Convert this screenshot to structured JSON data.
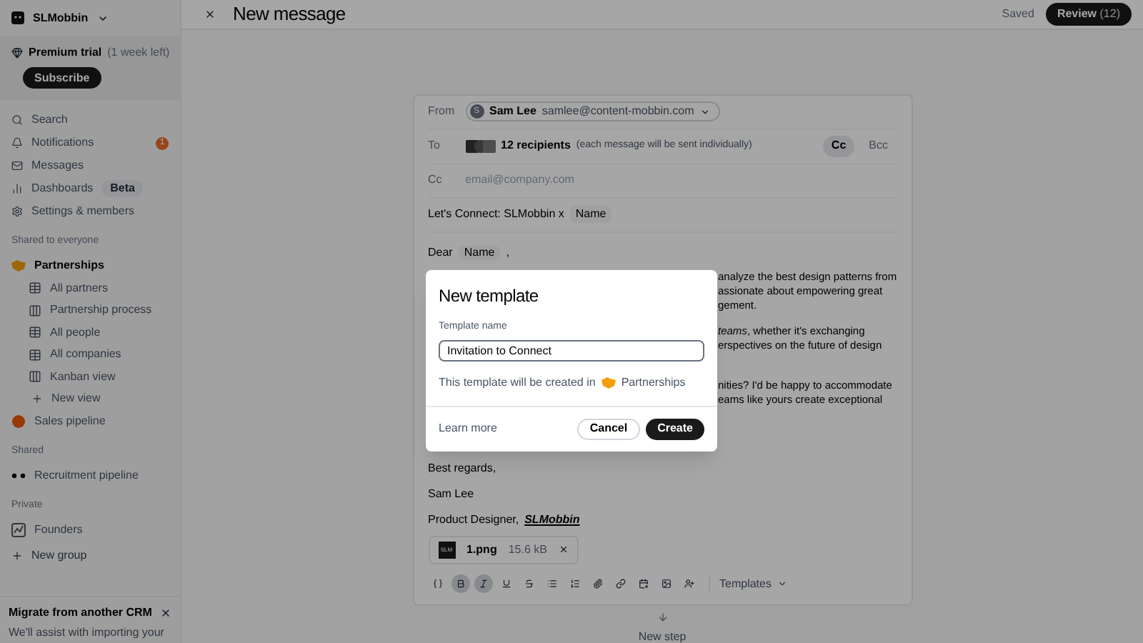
{
  "workspace": {
    "name": "SLMobbin"
  },
  "trial": {
    "label": "Premium trial",
    "note": "(1 week left)",
    "button": "Subscribe"
  },
  "nav": [
    {
      "label": "Search"
    },
    {
      "label": "Notifications",
      "badge": "1"
    },
    {
      "label": "Messages"
    },
    {
      "label": "Dashboards",
      "tag": "Beta"
    },
    {
      "label": "Settings & members"
    }
  ],
  "sections": [
    {
      "title": "Shared to everyone",
      "items": [
        {
          "label": "Partnerships",
          "expanded": true,
          "children": [
            {
              "label": "All partners"
            },
            {
              "label": "Partnership process"
            },
            {
              "label": "All people"
            },
            {
              "label": "All companies"
            },
            {
              "label": "Kanban view"
            }
          ],
          "action": "New view"
        },
        {
          "label": "Sales pipeline",
          "expanded": false
        }
      ]
    },
    {
      "title": "Shared",
      "items": [
        {
          "label": "Recruitment pipeline",
          "expanded": false
        }
      ]
    },
    {
      "title": "Private",
      "items": [
        {
          "label": "Founders",
          "expanded": false
        }
      ],
      "action": "New group"
    }
  ],
  "promo": {
    "title": "Migrate from another CRM",
    "text": "We'll assist with importing your"
  },
  "header": {
    "title": "New message",
    "status": "Saved",
    "button": "Review",
    "count": "(12)"
  },
  "compose": {
    "from_label": "From",
    "sender_initial": "S",
    "sender_name": "Sam Lee",
    "sender_email": "samlee@content-mobbin.com",
    "to_label": "To",
    "recipients": "12 recipients",
    "recipients_note": "(each message will be sent individually)",
    "copy_buttons": [
      {
        "label": "Cc",
        "selected": true
      },
      {
        "label": "Bcc",
        "selected": false
      }
    ],
    "cc_label": "Cc",
    "cc_placeholder": "email@company.com",
    "subject": "Let's Connect: SLMobbin x",
    "subject_tag": "Name",
    "greeting": "Dear",
    "greeting_tag": "Name",
    "greeting_end": ",",
    "paragraphs": [
      [
        "analyze the best design patterns from",
        "assionate about empowering great",
        "gement."
      ],
      [
        "*teams*, whether it's exchanging",
        "erspectives on the future of design"
      ],
      [
        "nities? I'd be happy to accommodate",
        "eams like yours create exceptional"
      ]
    ],
    "closing": "Best regards,",
    "signature_name": "Sam Lee",
    "signature_title": "Product Designer,",
    "signature_company": "SLMobbin",
    "attachment": {
      "thumb": "SLM",
      "name": "1.png",
      "size": "15.6 kB"
    },
    "toolbar": [
      {
        "active": false
      },
      {
        "active": true
      },
      {
        "active": true
      },
      {
        "active": false
      },
      {
        "active": false
      },
      {
        "active": false
      },
      {
        "active": false
      },
      {
        "active": false
      },
      {
        "active": false
      },
      {
        "active": false
      },
      {
        "active": false
      },
      {
        "active": false
      }
    ],
    "templates": "Templates"
  },
  "next_step": "New step",
  "dialog": {
    "title": "New template",
    "field_label": "Template name",
    "value": "Invitation to Connect",
    "note": "This template will be created in",
    "target": "Partnerships",
    "link": "Learn more",
    "cancel": "Cancel",
    "create": "Create"
  }
}
